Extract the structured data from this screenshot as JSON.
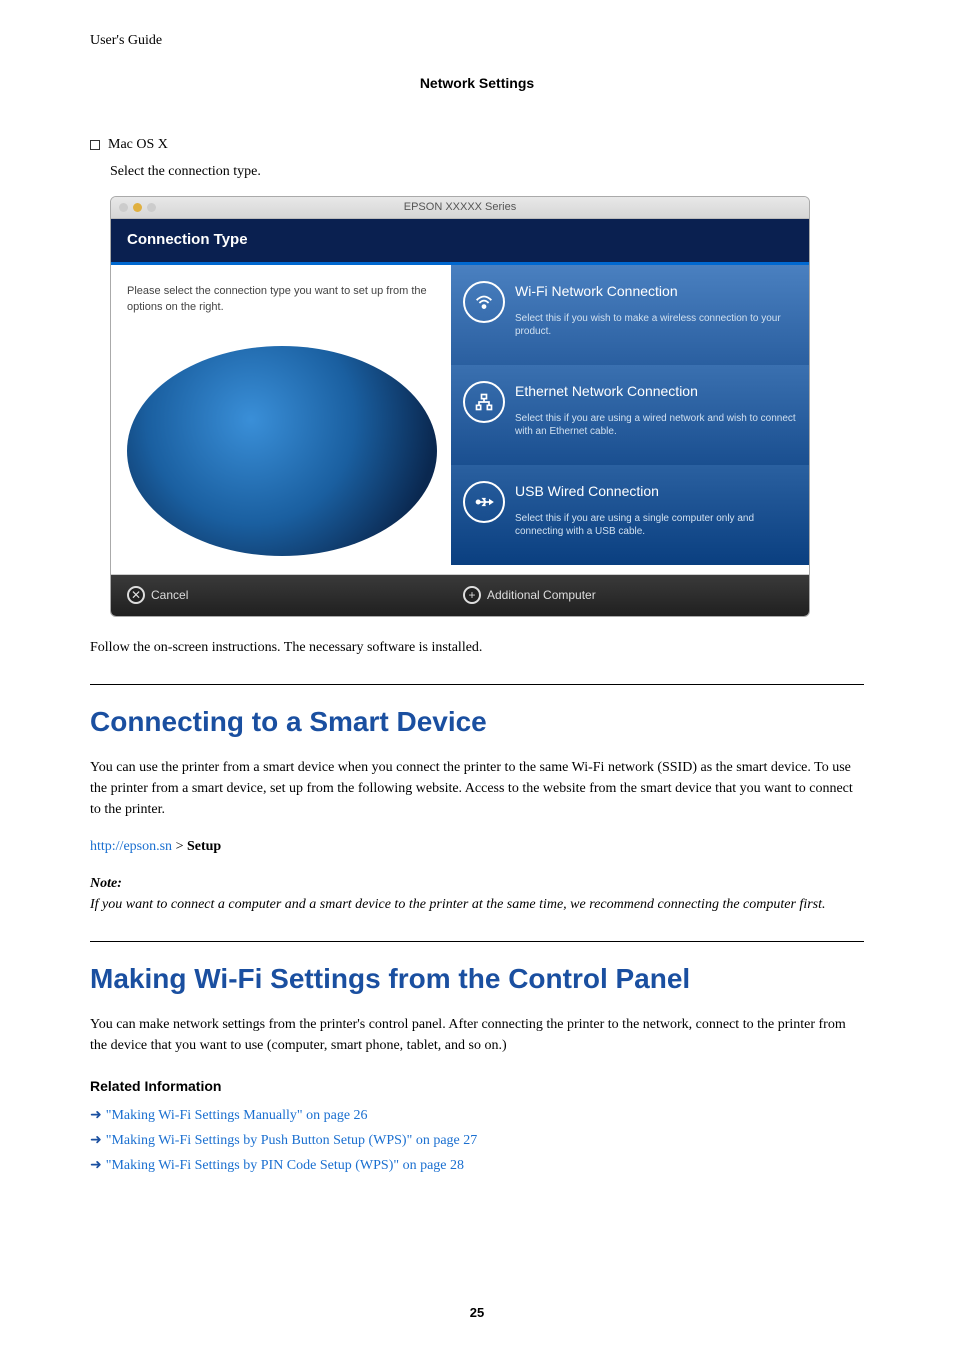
{
  "header_left": "User's Guide",
  "section_center": "Network Settings",
  "bullet_os": "Mac OS X",
  "bullet_instruction": "Select the connection type.",
  "screenshot": {
    "window_title": "EPSON XXXXX Series",
    "panel_title": "Connection Type",
    "left_instruction": "Please select the connection type you want to set up from the options on the right.",
    "wifi": {
      "title": "Wi-Fi Network Connection",
      "desc": "Select this if you wish to make a wireless connection to your product."
    },
    "ethernet": {
      "title": "Ethernet Network Connection",
      "desc": "Select this if you are using a wired network and wish to connect with an Ethernet cable."
    },
    "usb": {
      "title": "USB Wired Connection",
      "desc": "Select this if you are using a single computer only and connecting with a USB cable."
    },
    "cancel": "Cancel",
    "additional": "Additional Computer"
  },
  "follow_text": "Follow the on-screen instructions. The necessary software is installed.",
  "h2_smart": "Connecting to a Smart Device",
  "smart_para": "You can use the printer from a smart device when you connect the printer to the same Wi-Fi network (SSID) as the smart device. To use the printer from a smart device, set up from the following website. Access to the website from the smart device that you want to connect to the printer.",
  "setup_url": "http://epson.sn",
  "setup_gt": " > ",
  "setup_bold": "Setup",
  "note_label": "Note:",
  "note_body": "If you want to connect a computer and a smart device to the printer at the same time, we recommend connecting the computer first.",
  "h2_wifi": "Making Wi-Fi Settings from the Control Panel",
  "wifi_para": "You can make network settings from the printer's control panel. After connecting the printer to the network, connect to the printer from the device that you want to use (computer, smart phone, tablet, and so on.)",
  "related_title": "Related Information",
  "rel1": "\"Making Wi-Fi Settings Manually\" on page 26",
  "rel2": "\"Making Wi-Fi Settings by Push Button Setup (WPS)\" on page 27",
  "rel3": "\"Making Wi-Fi Settings by PIN Code Setup (WPS)\" on page 28",
  "page_number": "25"
}
